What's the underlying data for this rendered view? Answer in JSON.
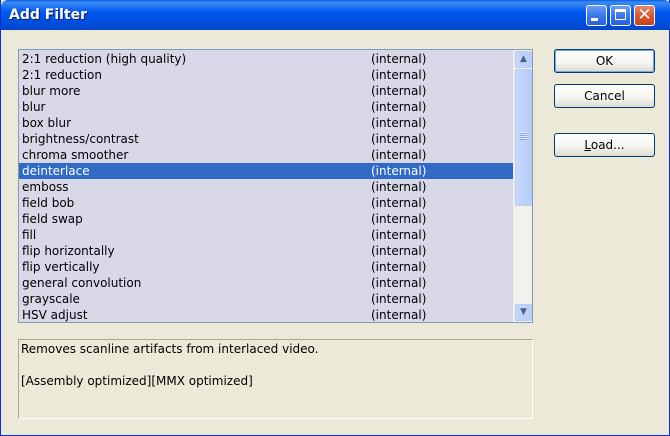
{
  "window": {
    "title": "Add Filter"
  },
  "filters": [
    {
      "name": "2:1 reduction (high quality)",
      "type": "(internal)"
    },
    {
      "name": "2:1 reduction",
      "type": "(internal)"
    },
    {
      "name": "blur more",
      "type": "(internal)"
    },
    {
      "name": "blur",
      "type": "(internal)"
    },
    {
      "name": "box blur",
      "type": "(internal)"
    },
    {
      "name": "brightness/contrast",
      "type": "(internal)"
    },
    {
      "name": "chroma smoother",
      "type": "(internal)"
    },
    {
      "name": "deinterlace",
      "type": "(internal)",
      "selected": true
    },
    {
      "name": "emboss",
      "type": "(internal)"
    },
    {
      "name": "field bob",
      "type": "(internal)"
    },
    {
      "name": "field swap",
      "type": "(internal)"
    },
    {
      "name": "fill",
      "type": "(internal)"
    },
    {
      "name": "flip horizontally",
      "type": "(internal)"
    },
    {
      "name": "flip vertically",
      "type": "(internal)"
    },
    {
      "name": "general convolution",
      "type": "(internal)"
    },
    {
      "name": "grayscale",
      "type": "(internal)"
    },
    {
      "name": "HSV adjust",
      "type": "(internal)"
    }
  ],
  "description": {
    "line1": "Removes scanline artifacts from interlaced video.",
    "line2": "[Assembly optimized][MMX optimized]"
  },
  "buttons": {
    "ok": "OK",
    "cancel": "Cancel",
    "load_prefix": "",
    "load_mnemonic": "L",
    "load_suffix": "oad..."
  },
  "colors": {
    "selection": "#316ac5",
    "list_background": "#d8d8e8",
    "titlebar": "#0058ee"
  },
  "icons": {
    "scroll_up": "up-arrow-icon",
    "scroll_down": "down-arrow-icon",
    "close": "close-icon",
    "minimize": "minimize-icon",
    "maximize": "maximize-icon"
  }
}
